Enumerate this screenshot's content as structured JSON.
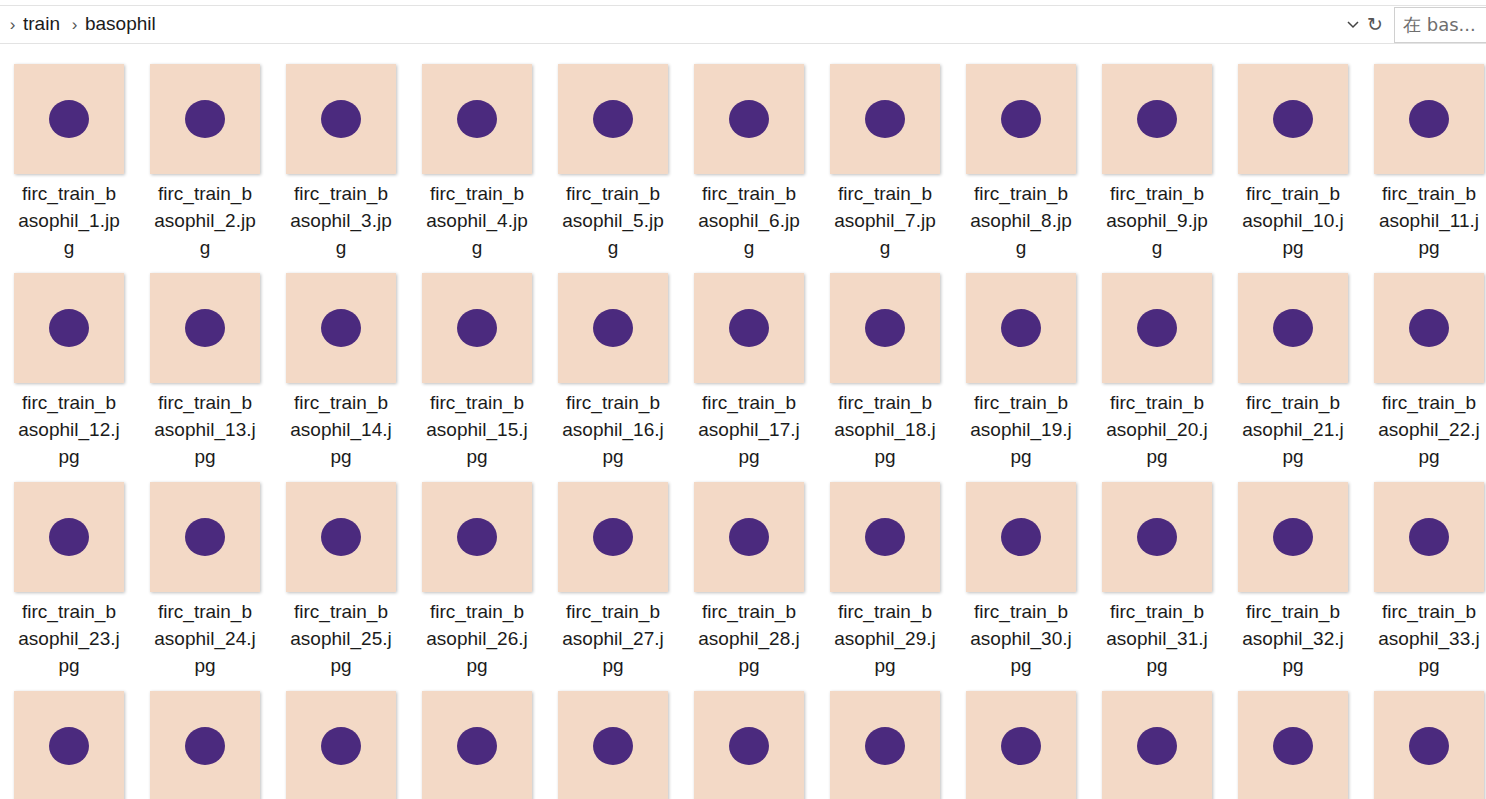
{
  "breadcrumb": [
    {
      "separator": "›",
      "label": "train"
    },
    {
      "separator": "›",
      "label": "basophil"
    }
  ],
  "address_bar": {
    "refresh": "↻"
  },
  "search": {
    "placeholder": "在 bas..."
  },
  "files": [
    {
      "label": "firc_train_basophil_1.jpg"
    },
    {
      "label": "firc_train_basophil_2.jpg"
    },
    {
      "label": "firc_train_basophil_3.jpg"
    },
    {
      "label": "firc_train_basophil_4.jpg"
    },
    {
      "label": "firc_train_basophil_5.jpg"
    },
    {
      "label": "firc_train_basophil_6.jpg"
    },
    {
      "label": "firc_train_basophil_7.jpg"
    },
    {
      "label": "firc_train_basophil_8.jpg"
    },
    {
      "label": "firc_train_basophil_9.jpg"
    },
    {
      "label": "firc_train_basophil_10.jpg"
    },
    {
      "label": "firc_train_basophil_11.jpg"
    },
    {
      "label": "firc_train_basophil_12.jpg"
    },
    {
      "label": "firc_train_basophil_13.jpg"
    },
    {
      "label": "firc_train_basophil_14.jpg"
    },
    {
      "label": "firc_train_basophil_15.jpg"
    },
    {
      "label": "firc_train_basophil_16.jpg"
    },
    {
      "label": "firc_train_basophil_17.jpg"
    },
    {
      "label": "firc_train_basophil_18.jpg"
    },
    {
      "label": "firc_train_basophil_19.jpg"
    },
    {
      "label": "firc_train_basophil_20.jpg"
    },
    {
      "label": "firc_train_basophil_21.jpg"
    },
    {
      "label": "firc_train_basophil_22.jpg"
    },
    {
      "label": "firc_train_basophil_23.jpg"
    },
    {
      "label": "firc_train_basophil_24.jpg"
    },
    {
      "label": "firc_train_basophil_25.jpg"
    },
    {
      "label": "firc_train_basophil_26.jpg"
    },
    {
      "label": "firc_train_basophil_27.jpg"
    },
    {
      "label": "firc_train_basophil_28.jpg"
    },
    {
      "label": "firc_train_basophil_29.jpg"
    },
    {
      "label": "firc_train_basophil_30.jpg"
    },
    {
      "label": "firc_train_basophil_31.jpg"
    },
    {
      "label": "firc_train_basophil_32.jpg"
    },
    {
      "label": "firc_train_basophil_33.jpg"
    },
    {
      "label": ""
    },
    {
      "label": ""
    },
    {
      "label": ""
    },
    {
      "label": ""
    },
    {
      "label": ""
    },
    {
      "label": ""
    },
    {
      "label": ""
    },
    {
      "label": ""
    },
    {
      "label": ""
    },
    {
      "label": ""
    },
    {
      "label": ""
    }
  ]
}
